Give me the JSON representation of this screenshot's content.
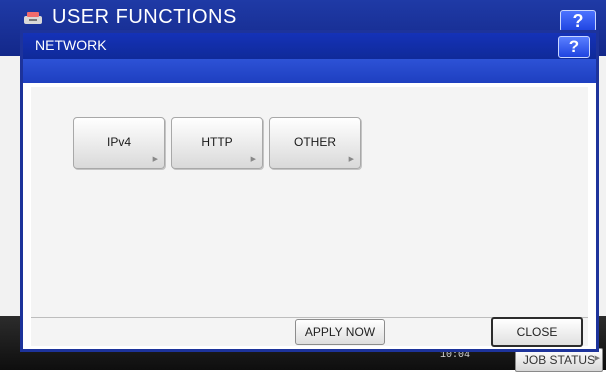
{
  "background": {
    "title": "USER FUNCTIONS",
    "help_label": "?",
    "clock": "10:04",
    "job_status_label": "JOB STATUS"
  },
  "dialog": {
    "title": "NETWORK",
    "help_label": "?",
    "options": [
      {
        "label": "IPv4"
      },
      {
        "label": "HTTP"
      },
      {
        "label": "OTHER"
      }
    ],
    "apply_label": "APPLY NOW",
    "close_label": "CLOSE"
  },
  "colors": {
    "titlebar": "#1532b8",
    "subbar": "#2d52d6",
    "border": "#1d339b"
  }
}
